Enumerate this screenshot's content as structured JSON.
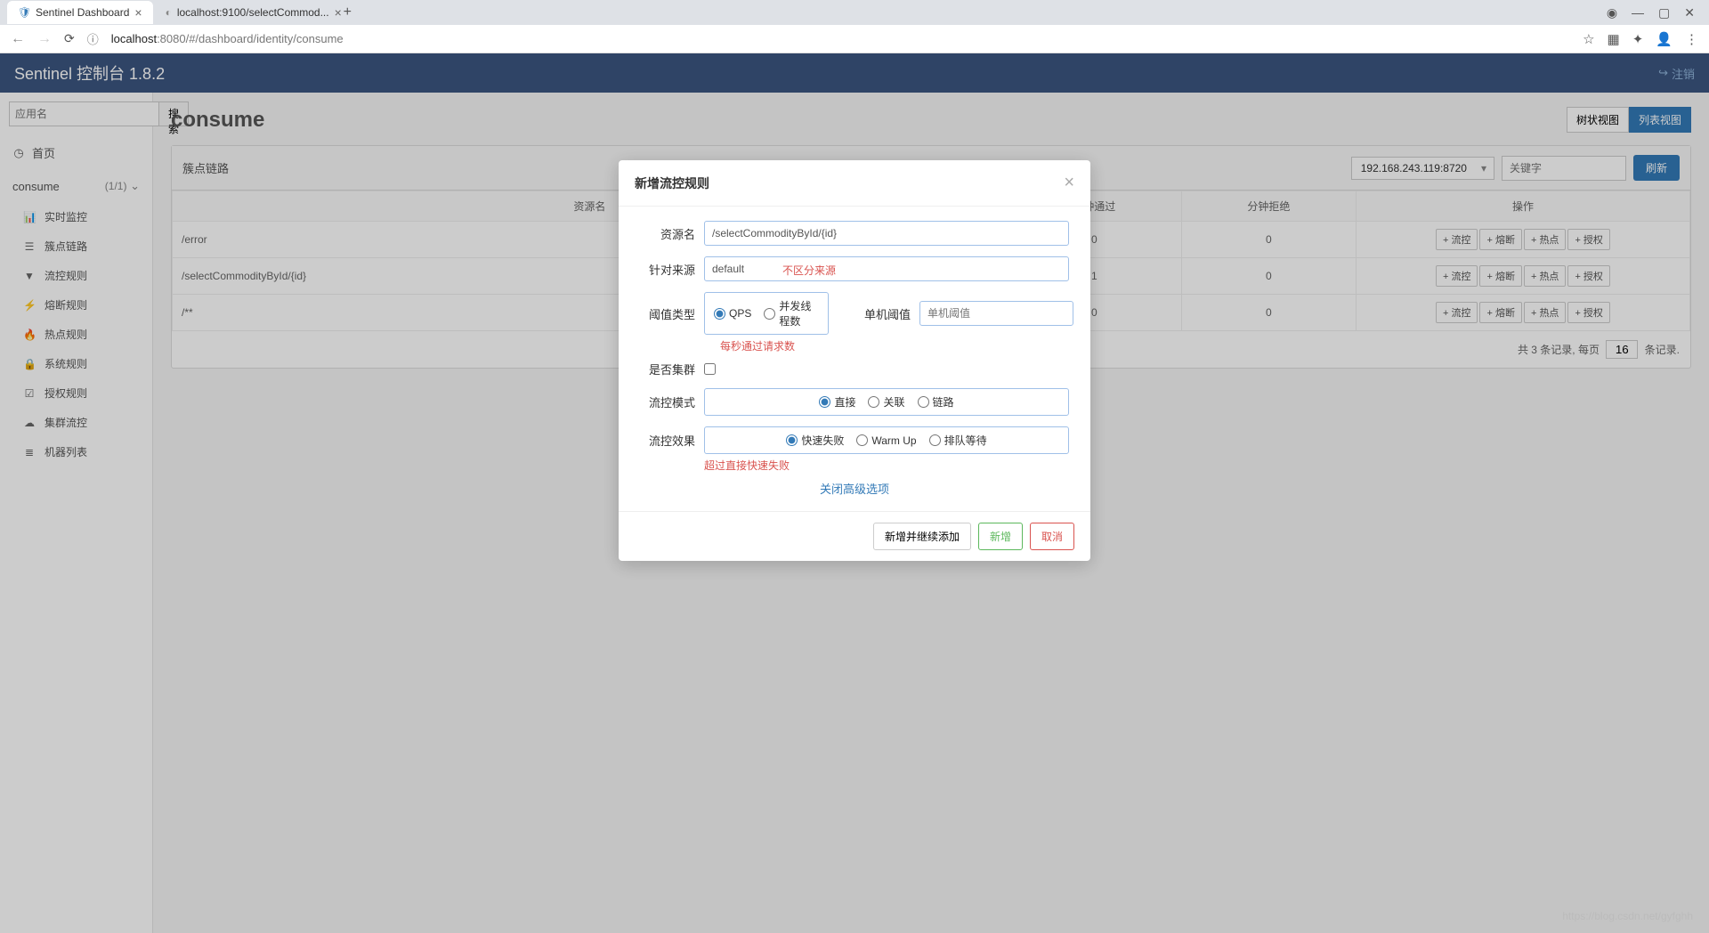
{
  "browser": {
    "tabs": [
      {
        "icon": "🛡",
        "icon_color": "#337ab7",
        "title": "Sentinel Dashboard",
        "active": true
      },
      {
        "icon": "◐",
        "icon_color": "#888",
        "title": "localhost:9100/selectCommod...",
        "active": false
      }
    ],
    "url_host": "localhost",
    "url_path": ":8080/#/dashboard/identity/consume"
  },
  "header": {
    "title": "Sentinel 控制台 1.8.2",
    "logout": "注销"
  },
  "sidebar": {
    "search_placeholder": "应用名",
    "search_btn": "搜索",
    "home": "首页",
    "section": "consume",
    "section_count": "(1/1)",
    "items": [
      {
        "icon": "📊",
        "label": "实时监控"
      },
      {
        "icon": "☰",
        "label": "簇点链路"
      },
      {
        "icon": "▼",
        "label": "流控规则"
      },
      {
        "icon": "⚡",
        "label": "熔断规则"
      },
      {
        "icon": "🔥",
        "label": "热点规则"
      },
      {
        "icon": "🔒",
        "label": "系统规则"
      },
      {
        "icon": "☑",
        "label": "授权规则"
      },
      {
        "icon": "☁",
        "label": "集群流控"
      },
      {
        "icon": "≣",
        "label": "机器列表"
      }
    ]
  },
  "main": {
    "title": "consume",
    "view_tree": "树状视图",
    "view_list": "列表视图",
    "panel_title": "簇点链路",
    "machine": "192.168.243.119:8720",
    "keyword_placeholder": "关键字",
    "refresh": "刷新",
    "columns": [
      "资源名",
      "分钟通过",
      "分钟拒绝",
      "操作"
    ],
    "ops": [
      "流控",
      "熔断",
      "热点",
      "授权"
    ],
    "rows": [
      {
        "name": "/error",
        "pass": "0",
        "reject": "0"
      },
      {
        "name": "/selectCommodityById/{id}",
        "pass": "1",
        "reject": "0"
      },
      {
        "name": "/**",
        "pass": "0",
        "reject": "0"
      }
    ],
    "footer_total": "共 3 条记录, 每页",
    "footer_per": "16",
    "footer_suffix": "条记录."
  },
  "modal": {
    "title": "新增流控规则",
    "labels": {
      "resource": "资源名",
      "source": "针对来源",
      "threshold_type": "阈值类型",
      "threshold": "单机阈值",
      "cluster": "是否集群",
      "mode": "流控模式",
      "effect": "流控效果"
    },
    "resource_value": "/selectCommodityById/{id}",
    "source_value": "default",
    "source_annot": "不区分来源",
    "threshold_opts": [
      "QPS",
      "并发线程数"
    ],
    "threshold_annot": "每秒通过请求数",
    "threshold_placeholder": "单机阈值",
    "mode_opts": [
      "直接",
      "关联",
      "链路"
    ],
    "effect_opts": [
      "快速失败",
      "Warm Up",
      "排队等待"
    ],
    "effect_annot": "超过直接快速失败",
    "adv_link": "关闭高级选项",
    "btn_add_continue": "新增并继续添加",
    "btn_add": "新增",
    "btn_cancel": "取消"
  },
  "watermark": "https://blog.csdn.net/gyfghh"
}
